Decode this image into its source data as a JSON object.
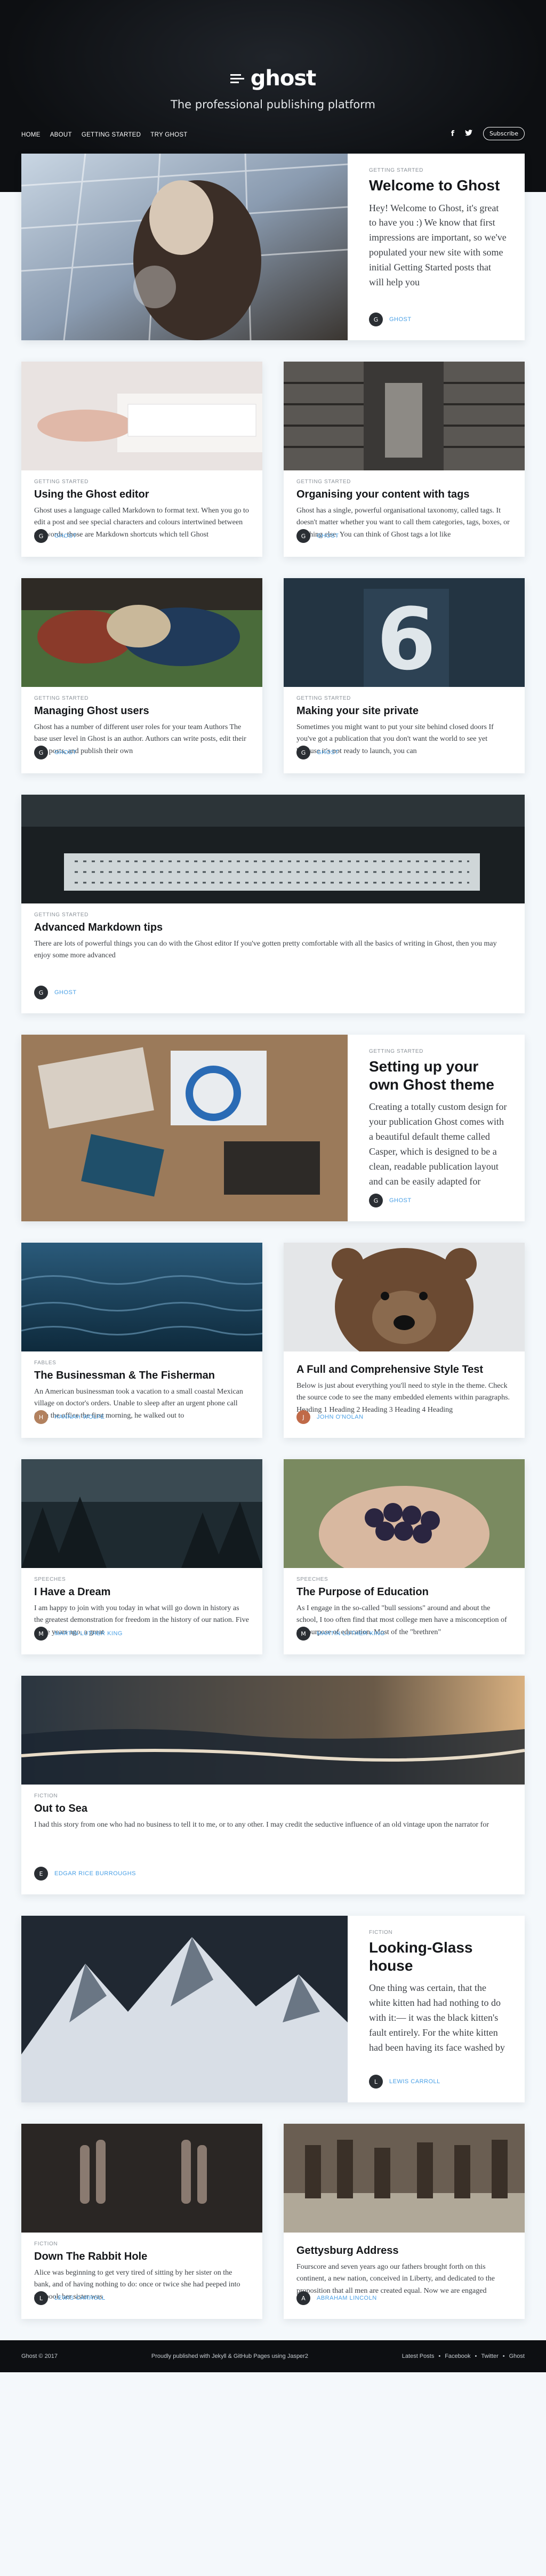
{
  "site": {
    "title": "ghost",
    "tagline": "The professional publishing platform"
  },
  "nav": {
    "items": [
      "HOME",
      "ABOUT",
      "GETTING STARTED",
      "TRY GHOST"
    ],
    "subscribe": "Subscribe",
    "icons": [
      "facebook-icon",
      "twitter-icon"
    ]
  },
  "posts": [
    {
      "tag": "GETTING STARTED",
      "title": "Welcome to Ghost",
      "excerpt": "Hey! Welcome to Ghost, it's great to have you :) We know that first impressions are important, so we've populated your new site with some initial Getting Started posts that will help you",
      "author": "GHOST"
    },
    {
      "tag": "GETTING STARTED",
      "title": "Using the Ghost editor",
      "excerpt": "Ghost uses a language called Markdown to format text. When you go to edit a post and see special characters and colours intertwined between the words, those are Markdown shortcuts which tell Ghost",
      "author": "GHOST"
    },
    {
      "tag": "GETTING STARTED",
      "title": "Organising your content with tags",
      "excerpt": "Ghost has a single, powerful organisational taxonomy, called tags. It doesn't matter whether you want to call them categories, tags, boxes, or anything else. You can think of Ghost tags a lot like",
      "author": "GHOST"
    },
    {
      "tag": "GETTING STARTED",
      "title": "Managing Ghost users",
      "excerpt": "Ghost has a number of different user roles for your team Authors The base user level in Ghost is an author. Authors can write posts, edit their own posts, and publish their own",
      "author": "GHOST"
    },
    {
      "tag": "GETTING STARTED",
      "title": "Making your site private",
      "excerpt": "Sometimes you might want to put your site behind closed doors If you've got a publication that you don't want the world to see yet because it's not ready to launch, you can",
      "author": "GHOST"
    },
    {
      "tag": "GETTING STARTED",
      "title": "Advanced Markdown tips",
      "excerpt": "There are lots of powerful things you can do with the Ghost editor If you've gotten pretty comfortable with all the basics of writing in Ghost, then you may enjoy some more advanced",
      "author": "GHOST"
    },
    {
      "tag": "GETTING STARTED",
      "title": "Setting up your own Ghost theme",
      "excerpt": "Creating a totally custom design for your publication Ghost comes with a beautiful default theme called Casper, which is designed to be a clean, readable publication layout and can be easily adapted for",
      "author": "GHOST"
    },
    {
      "tag": "FABLES",
      "title": "The Businessman & The Fisherman",
      "excerpt": "An American businessman took a vacation to a small coastal Mexican village on doctor's orders. Unable to sleep after an urgent phone call from the office the first morning, he walked out to",
      "author": "HANNAH WOLFE"
    },
    {
      "tag": "",
      "title": "A Full and Comprehensive Style Test",
      "excerpt": "Below is just about everything you'll need to style in the theme. Check the source code to see the many embedded elements within paragraphs. Heading 1 Heading 2 Heading 3 Heading 4 Heading",
      "author": "JOHN O'NOLAN"
    },
    {
      "tag": "SPEECHES",
      "title": "I Have a Dream",
      "excerpt": "I am happy to join with you today in what will go down in history as the greatest demonstration for freedom in the history of our nation. Five score years ago, a great",
      "author": "MARTIN LUTHER KING"
    },
    {
      "tag": "SPEECHES",
      "title": "The Purpose of Education",
      "excerpt": "As I engage in the so-called \"bull sessions\" around and about the school, I too often find that most college men have a misconception of the purpose of education. Most of the \"brethren\"",
      "author": "MARTIN LUTHER KING"
    },
    {
      "tag": "FICTION",
      "title": "Out to Sea",
      "excerpt": "I had this story from one who had no business to tell it to me, or to any other. I may credit the seductive influence of an old vintage upon the narrator for",
      "author": "EDGAR RICE BURROUGHS"
    },
    {
      "tag": "FICTION",
      "title": "Looking-Glass house",
      "excerpt": "One thing was certain, that the white kitten had had nothing to do with it:— it was the black kitten's fault entirely. For the white kitten had been having its face washed by",
      "author": "LEWIS CARROLL"
    },
    {
      "tag": "FICTION",
      "title": "Down The Rabbit Hole",
      "excerpt": "Alice was beginning to get very tired of sitting by her sister on the bank, and of having nothing to do: once or twice she had peeped into the book her sister was",
      "author": "LEWIS CARROLL"
    },
    {
      "tag": "",
      "title": "Gettysburg Address",
      "excerpt": "Fourscore and seven years ago our fathers brought forth on this continent, a new nation, conceived in Liberty, and dedicated to the proposition that all men are created equal. Now we are engaged",
      "author": "ABRAHAM LINCOLN"
    }
  ],
  "footer": {
    "copy": "Ghost © 2017",
    "credit": "Proudly published with Jekyll & GitHub Pages using Jasper2",
    "links": [
      "Latest Posts",
      "Facebook",
      "Twitter",
      "Ghost"
    ],
    "sep": "•"
  }
}
